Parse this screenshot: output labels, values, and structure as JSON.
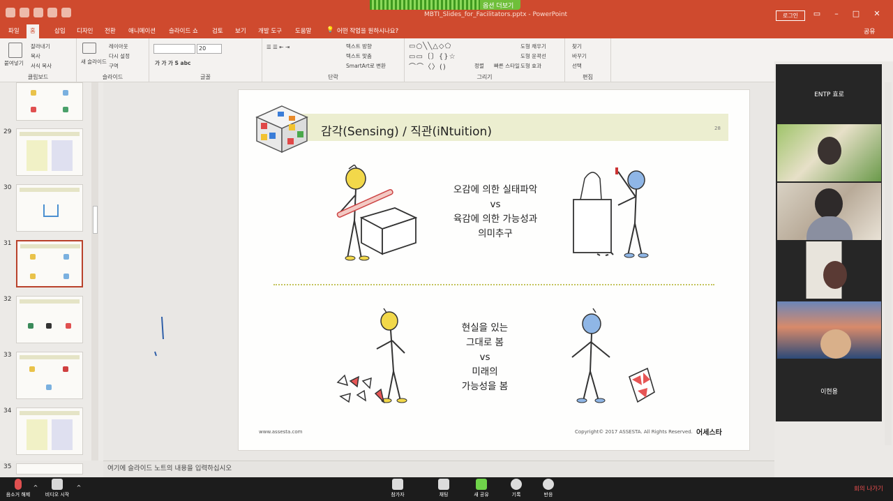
{
  "zoom": {
    "share_label": "옵션 더보기",
    "leave_label": "회의 나가기",
    "toolbar": [
      {
        "label": "음소거 해제"
      },
      {
        "label": "비디오 시작"
      },
      {
        "label": "참가자"
      },
      {
        "label": "채팅"
      },
      {
        "label": "새 공유"
      },
      {
        "label": "기록"
      },
      {
        "label": "반응"
      }
    ],
    "participants": [
      {
        "name": "ENTP 효로"
      },
      {
        "name": ""
      },
      {
        "name": ""
      },
      {
        "name": ""
      },
      {
        "name": ""
      },
      {
        "name": "이현용"
      }
    ]
  },
  "powerpoint": {
    "doc_title": "MBTI_Slides_for_Facilitators.pptx - PowerPoint",
    "login": "로그인",
    "share": "공유",
    "tabs": [
      "파일",
      "홈",
      "삽입",
      "디자인",
      "전환",
      "애니메이션",
      "슬라이드 쇼",
      "검토",
      "보기",
      "개발 도구",
      "도움말",
      "어떤 작업을 원하시나요?"
    ],
    "ribbon": {
      "clipboard": {
        "label": "클립보드",
        "paste": "붙여넣기",
        "cut": "잘라내기",
        "copy": "복사",
        "format": "서식 복사"
      },
      "slides": {
        "label": "슬라이드",
        "new": "새 슬라이드",
        "layout": "레이아웃",
        "reset": "다시 설정",
        "section": "구역"
      },
      "font": {
        "label": "글꼴",
        "size": "20"
      },
      "paragraph": {
        "label": "단락",
        "dir": "텍스트 방향",
        "align": "텍스트 맞춤",
        "smart": "SmartArt로 변환"
      },
      "drawing": {
        "label": "그리기",
        "arrange": "정렬",
        "styles": "빠른 스타일",
        "fill": "도형 채우기",
        "outline": "도형 윤곽선",
        "effects": "도형 효과"
      },
      "editing": {
        "label": "편집",
        "find": "찾기",
        "replace": "바꾸기",
        "select": "선택"
      }
    },
    "thumbnails": [
      {
        "num": ""
      },
      {
        "num": "29"
      },
      {
        "num": "30"
      },
      {
        "num": "31"
      },
      {
        "num": "32"
      },
      {
        "num": "33"
      },
      {
        "num": "34"
      },
      {
        "num": "35"
      }
    ],
    "notes_placeholder": "여기에 슬라이드 노트의 내용을 입력하십시오",
    "slide": {
      "title": "감각(Sensing) / 직관(iNtuition)",
      "page_num": "28",
      "top_text": [
        "오감에 의한 실태파악",
        "vs",
        "육감에 의한 가능성과",
        "의미추구"
      ],
      "bottom_text": [
        "현실을 있는",
        "그대로 봄",
        "vs",
        "미래의",
        "가능성을 봄"
      ],
      "footer_url": "www.assesta.com",
      "footer_copy": "Copyright© 2017 ASSESTA. All Rights Reserved.",
      "footer_brand": "어세스타"
    }
  },
  "colors": {
    "ppt_accent": "#cf4a2e",
    "zoom_share": "#6fbf3a",
    "header_band": "#eceed0"
  }
}
